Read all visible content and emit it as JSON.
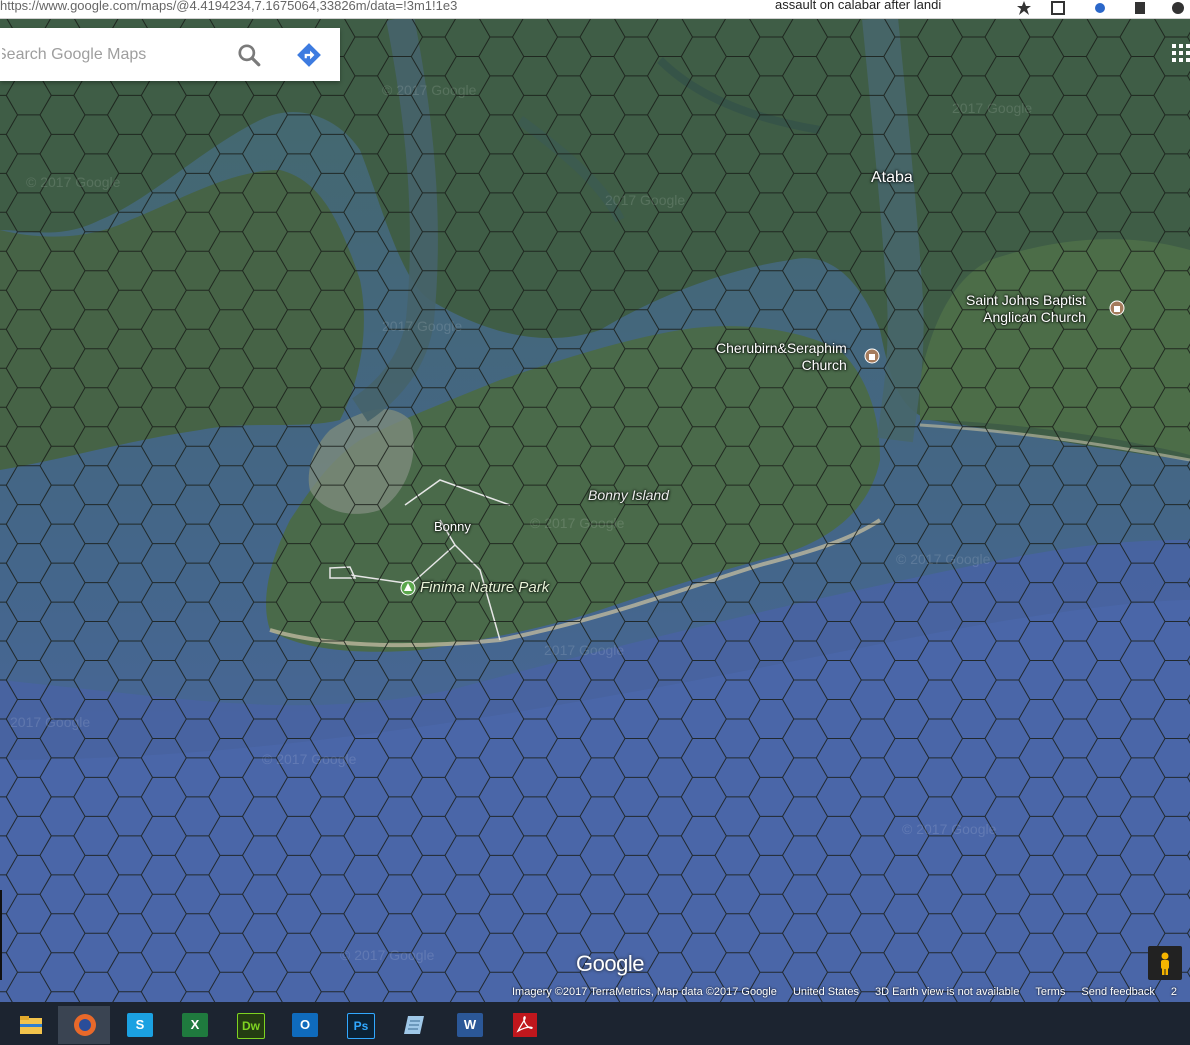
{
  "browser": {
    "url": "https://www.google.com/maps/@4.4194234,7.1675064,33826m/data=!3m1!1e3",
    "tab_title": "assault on calabar after landi"
  },
  "search": {
    "placeholder": "Search Google Maps"
  },
  "map": {
    "places": {
      "ataba": "Ataba",
      "bonny": "Bonny",
      "bonny_island": "Bonny Island",
      "finima": "Finima Nature Park",
      "church1_line1": "Cherubirn&Seraphim",
      "church1_line2": "Church",
      "church2_line1": "Saint Johns Baptist",
      "church2_line2": "Anglican Church"
    },
    "watermark": "© 2017 Google",
    "watermark_partial": "2017 Google",
    "logo": "Google"
  },
  "attribution": {
    "imagery": "Imagery ©2017 TerraMetrics, Map data ©2017 Google",
    "country": "United States",
    "view_note": "3D Earth view is not available",
    "terms": "Terms",
    "feedback": "Send feedback",
    "scale": "2"
  },
  "taskbar": {
    "items": [
      {
        "name": "file-explorer-icon",
        "letter": ""
      },
      {
        "name": "firefox-icon",
        "letter": ""
      },
      {
        "name": "skype-icon",
        "letter": "S"
      },
      {
        "name": "excel-icon",
        "letter": "X"
      },
      {
        "name": "dreamweaver-icon",
        "letter": "Dw"
      },
      {
        "name": "outlook-icon",
        "letter": "O"
      },
      {
        "name": "photoshop-icon",
        "letter": "Ps"
      },
      {
        "name": "notepad-icon",
        "letter": ""
      },
      {
        "name": "word-icon",
        "letter": "W"
      },
      {
        "name": "acrobat-icon",
        "letter": ""
      }
    ]
  },
  "colors": {
    "land_dark": "#3d5a45",
    "land": "#4a6a4c",
    "water_shallow": "#3f6a6a",
    "ocean": "#4a67a6",
    "beach": "#b9b59a",
    "hex_line": "#1a1f1a"
  }
}
